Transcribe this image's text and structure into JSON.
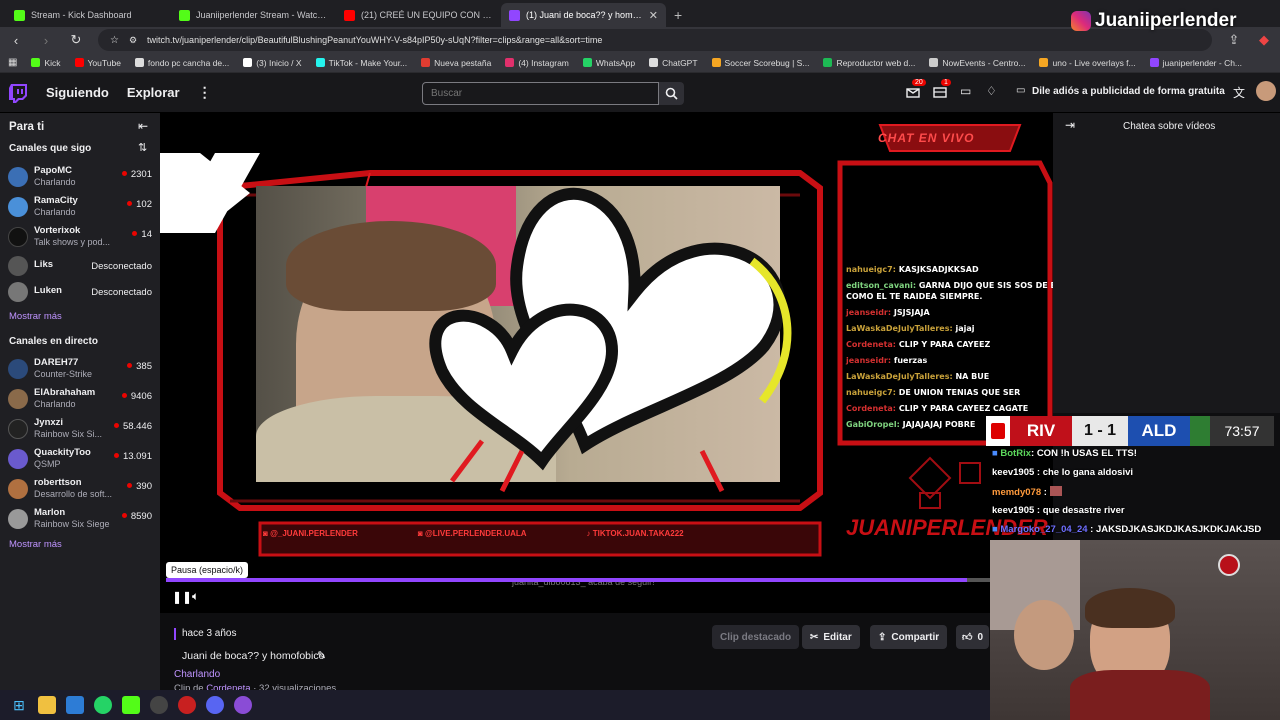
{
  "browser": {
    "tabs": [
      {
        "label": "Stream - Kick Dashboard",
        "color": "#53fc18",
        "active": false
      },
      {
        "label": "Juaniiperlender Stream - Watch Live on Kick",
        "color": "#53fc18",
        "active": false
      },
      {
        "label": "(21) CREÉ UN EQUIPO CON MI CHAT",
        "color": "#ff0000",
        "active": false
      },
      {
        "label": "(1) Juani de boca?? y homofobico",
        "color": "#9146ff",
        "active": true
      }
    ],
    "url": "twitch.tv/juaniperlender/clip/BeautifulBlushingPeanutYouWHY-V-s84pIP50y-sUqN?filter=clips&range=all&sort=time",
    "bookmarks": [
      {
        "label": "Kick",
        "color": "#53fc18"
      },
      {
        "label": "YouTube",
        "color": "#ff0000"
      },
      {
        "label": "fondo pc cancha de...",
        "color": "#dddddd"
      },
      {
        "label": "(3) Inicio / X",
        "color": "#ffffff"
      },
      {
        "label": "TikTok - Make Your...",
        "color": "#25f4ee"
      },
      {
        "label": "Nueva pestaña",
        "color": "#e03c31"
      },
      {
        "label": "(4) Instagram",
        "color": "#e1306c"
      },
      {
        "label": "WhatsApp",
        "color": "#25d366"
      },
      {
        "label": "ChatGPT",
        "color": "#dddddd"
      },
      {
        "label": "Soccer Scorebug | S...",
        "color": "#f5a623"
      },
      {
        "label": "Reproductor web d...",
        "color": "#1db954"
      },
      {
        "label": "NowEvents - Centro...",
        "color": "#cccccc"
      },
      {
        "label": "uno - Live overlays f...",
        "color": "#f5a623"
      },
      {
        "label": "juaniperlender - Ch...",
        "color": "#9146ff"
      }
    ]
  },
  "nav": {
    "following": "Siguiendo",
    "explore": "Explorar",
    "search_placeholder": "Buscar",
    "notif_badge": "20",
    "inbox_badge": "1",
    "ad_text": "Dile adiós a publicidad de forma gratuita"
  },
  "sidebar": {
    "for_you": "Para ti",
    "followed_title": "Canales que sigo",
    "followed": [
      {
        "name": "PapoMC",
        "game": "Charlando",
        "viewers": "2301",
        "color": "#3b6fb5"
      },
      {
        "name": "RamaCity",
        "game": "Charlando",
        "viewers": "102",
        "color": "#4a90d9"
      },
      {
        "name": "Vorterixok",
        "game": "Talk shows y pod...",
        "viewers": "14",
        "color": "#111111"
      },
      {
        "name": "Liks",
        "status": "Desconectado",
        "color": "#555555"
      },
      {
        "name": "Luken",
        "status": "Desconectado",
        "color": "#777777"
      }
    ],
    "show_more_1": "Mostrar más",
    "live_title": "Canales en directo",
    "live": [
      {
        "name": "DAREH77",
        "game": "Counter-Strike",
        "viewers": "385",
        "color": "#2b4a7a"
      },
      {
        "name": "ElAbrahaham",
        "game": "Charlando",
        "viewers": "9406",
        "color": "#8a6a4a"
      },
      {
        "name": "Jynxzi",
        "game": "Rainbow Six Si...",
        "viewers": "58.446",
        "color": "#222222"
      },
      {
        "name": "QuackityToo",
        "game": "QSMP",
        "viewers": "13.091",
        "color": "#6a5acd"
      },
      {
        "name": "roberttson",
        "game": "Desarrollo de soft...",
        "viewers": "390",
        "color": "#b07040"
      },
      {
        "name": "Marlon",
        "game": "Rainbow Six Siege",
        "viewers": "8590",
        "color": "#999999"
      }
    ],
    "show_more_2": "Mostrar más"
  },
  "overlay": {
    "chat_title": "CHAT EN VIVO",
    "chat": [
      {
        "user": "nahueigc7:",
        "text": "KASJKSADJKKSAD",
        "c": "y"
      },
      {
        "user": "editson_cavani:",
        "text": "GARNA DIJO QUE SIS SOS DE BOCA",
        "c": "g"
      },
      {
        "user": "",
        "text": "COMO EL TE RAIDEA SIEMPRE.",
        "c": "g"
      },
      {
        "user": "jeanseidr:",
        "text": "JSJSJAJA",
        "c": "r"
      },
      {
        "user": "LaWaskaDeJulyTalleres:",
        "text": "jajaj",
        "c": "y"
      },
      {
        "user": "Cordeneta:",
        "text": "CLIP Y PARA CAYEEZ",
        "c": "r"
      },
      {
        "user": "jeanseidr:",
        "text": "fuerzas",
        "c": "r"
      },
      {
        "user": "LaWaskaDeJulyTalleres:",
        "text": "NA BUE",
        "c": "y"
      },
      {
        "user": "nahueigc7:",
        "text": "DE UNION TENIAS QUE SER",
        "c": "y"
      },
      {
        "user": "Cordeneta:",
        "text": "CLIP Y PARA CAYEEZ CAGATE",
        "c": "r"
      },
      {
        "user": "GabiOropel:",
        "text": "JAJAJAJAJ POBRE",
        "c": "g"
      }
    ],
    "brand": "JUANIPERLENDER",
    "social_ig": "@_JUANI.PERLENDER",
    "social_tw": "@LIVE.PERLENDER.UALA",
    "social_tt": "TIKTOK.JUAN.TAKA222",
    "follow_alert": "juanita_dibo0813_ acaba de seguir!",
    "ig_handle": "Juaniiperlender"
  },
  "scorebug": {
    "home": "RIV",
    "away": "ALD",
    "score": "1 - 1",
    "time": "73:57"
  },
  "stream_chat": [
    {
      "user": "BotRix",
      "text": ": CON !h USAS EL TTS!",
      "color": "#5cd85c"
    },
    {
      "user": "keev1905",
      "text": ": che lo gana aldosivi",
      "color": "#ffffff"
    },
    {
      "user": "memdy078",
      "text": ":",
      "color": "#ff9a3c"
    },
    {
      "user": "keev1905",
      "text": ": que desastre river",
      "color": "#ffffff"
    },
    {
      "user": "Margoko_27_04_24",
      "text": ": JAKSDJKASJKDJKASJKDKJAKJSD",
      "color": "#6f6fff"
    }
  ],
  "player": {
    "tooltip": "Pausa (espacio/k)",
    "progress": 0.97
  },
  "chat_panel": {
    "title": "Chatea sobre vídeos"
  },
  "clip": {
    "time_ago": "hace 3 años",
    "title": "Juani de boca?? y homofobico",
    "category": "Charlando",
    "meta_prefix": "Clip de",
    "clipper": "Cordeneta",
    "views": "· 32 visualizaciones",
    "featured_label": "Clip destacado",
    "edit_label": "Editar",
    "share_label": "Compartir",
    "likes": "0"
  }
}
